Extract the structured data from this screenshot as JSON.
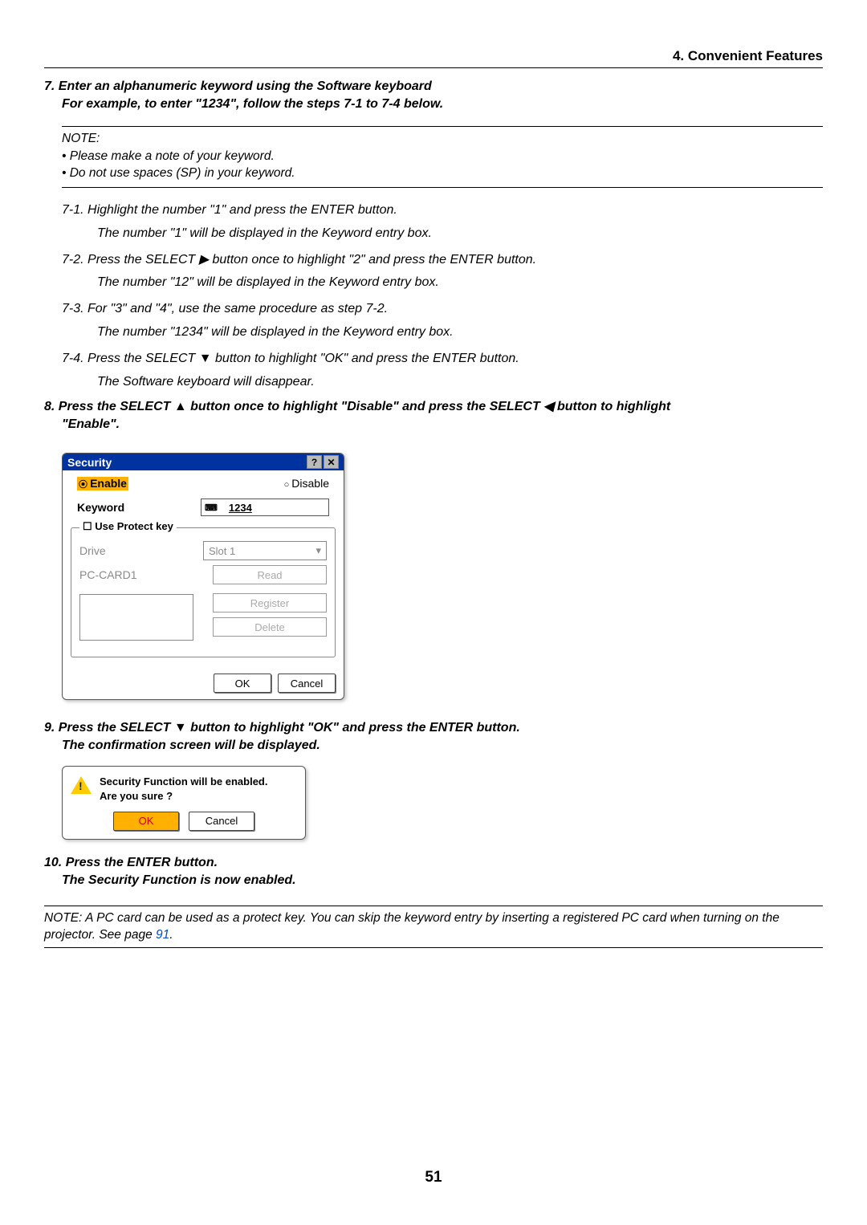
{
  "header": "4. Convenient Features",
  "step7_line1": "7.  Enter an alphanumeric keyword using the Software keyboard",
  "step7_line2": "For example, to enter \"1234\", follow the steps 7-1 to 7-4 below.",
  "noteLabel": "NOTE:",
  "noteBullet1": "• Please make a note of your keyword.",
  "noteBullet2": "• Do not use spaces (SP) in your keyword.",
  "s71a": "7-1.   Highlight the number \"1\" and press the ENTER button.",
  "s71b": "The number \"1\" will be displayed in the Keyword entry box.",
  "s72a": "7-2.   Press the SELECT ▶ button once to highlight \"2\" and press the ENTER button.",
  "s72b": "The number \"12\" will be displayed in the Keyword entry box.",
  "s73a": "7-3.   For \"3\" and \"4\", use the same procedure as step 7-2.",
  "s73b": "The number \"1234\" will be displayed in the Keyword entry box.",
  "s74a": "7-4.   Press the SELECT ▼ button to highlight \"OK\" and press the ENTER button.",
  "s74b": "The Software keyboard will disappear.",
  "step8a": "8.  Press the SELECT ▲ button once to highlight \"Disable\" and press the SELECT ◀ button to highlight",
  "step8b": "\"Enable\".",
  "dlg1": {
    "title": "Security",
    "enable": "Enable",
    "disable": "Disable",
    "keywordLabel": "Keyword",
    "keywordValue": "1234",
    "useProtect": "Use Protect key",
    "driveLabel": "Drive",
    "driveValue": "Slot 1",
    "pccard": "PC-CARD1",
    "read": "Read",
    "register": "Register",
    "delete": "Delete",
    "ok": "OK",
    "cancel": "Cancel"
  },
  "step9a": "9.  Press the SELECT ▼ button to highlight \"OK\" and press the ENTER button.",
  "step9b": "The confirmation screen will be displayed.",
  "dlg2": {
    "msg1": "Security Function will be enabled.",
    "msg2": "Are you sure ?",
    "ok": "OK",
    "cancel": "Cancel"
  },
  "step10a": "10. Press the ENTER button.",
  "step10b": "The Security Function is now enabled.",
  "finalNote": "NOTE: A PC card can be used as a protect key. You can skip the keyword entry by inserting a registered PC card when turning on the projector. See page ",
  "finalNoteLink": "91",
  "finalNoteEnd": ".",
  "pageNumber": "51"
}
